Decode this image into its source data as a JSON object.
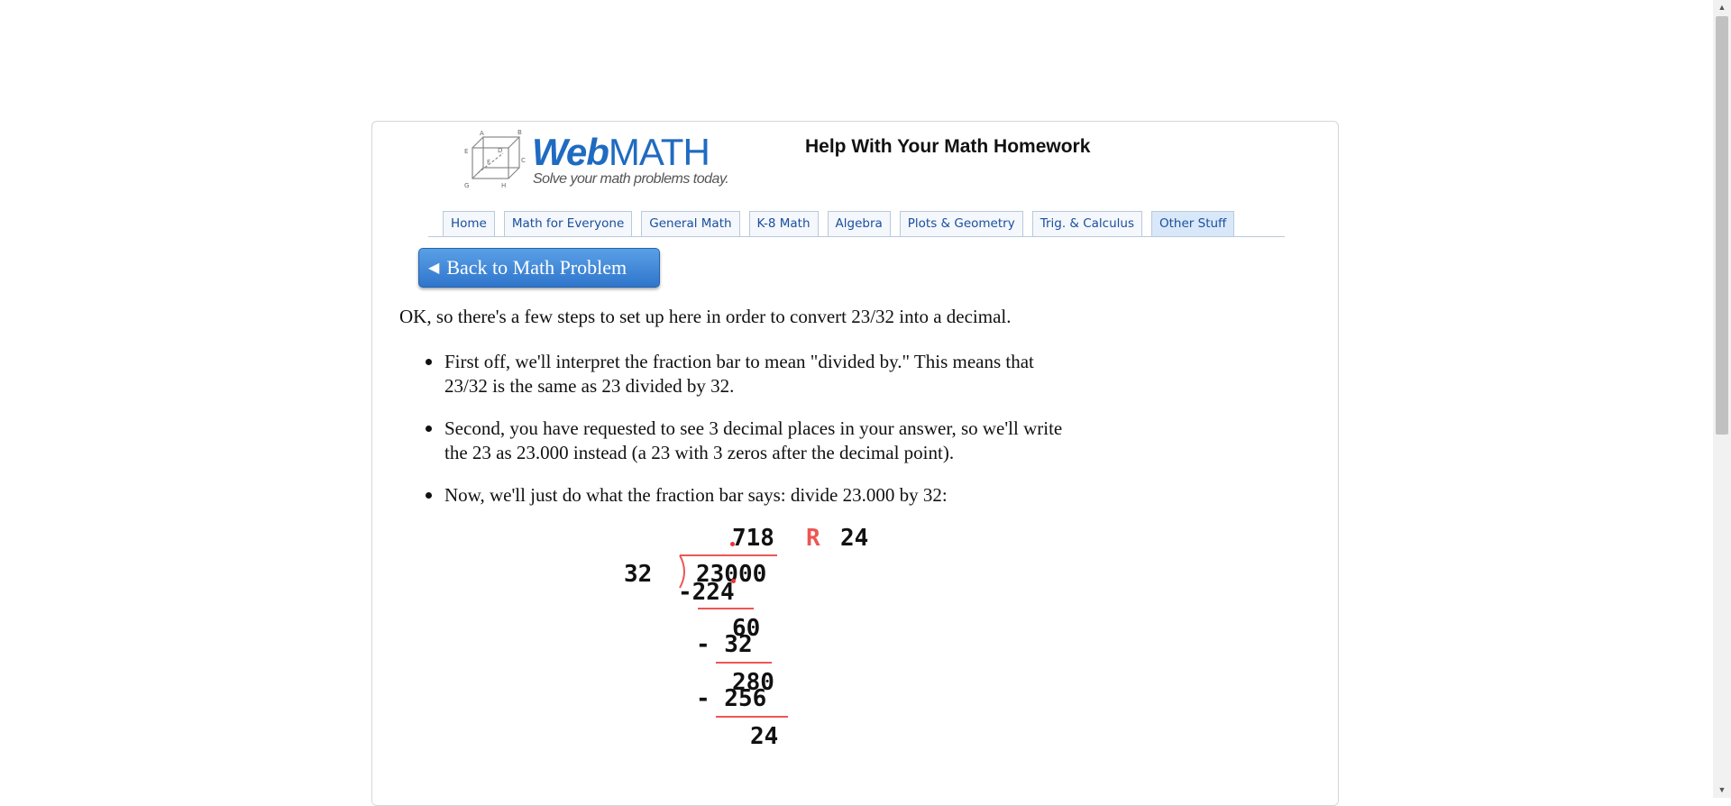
{
  "header": {
    "logo_word_a": "Web",
    "logo_word_b": "MATH",
    "logo_tagline": "Solve your math problems today.",
    "cube_labels": [
      "A",
      "B",
      "C",
      "D",
      "E",
      "F",
      "G",
      "H"
    ],
    "title": "Help With Your Math Homework"
  },
  "nav": {
    "tabs": [
      {
        "label": "Home"
      },
      {
        "label": "Math for Everyone"
      },
      {
        "label": "General Math"
      },
      {
        "label": "K-8 Math"
      },
      {
        "label": "Algebra"
      },
      {
        "label": "Plots & Geometry"
      },
      {
        "label": "Trig. & Calculus"
      },
      {
        "label": "Other Stuff"
      }
    ]
  },
  "back_button": {
    "icon": "left-triangle-icon",
    "label": "Back to Math Problem"
  },
  "content": {
    "intro": "OK, so there's a few steps to set up here in order to convert 23/32 into a decimal.",
    "steps": [
      {
        "line1": "First off, we'll interpret the fraction bar to mean \"divided by.\" This means that",
        "line2": "23/32 is the same as 23 divided by 32."
      },
      {
        "line1": "Second, you have requested to see 3 decimal places in your answer, so we'll write",
        "line2": "the 23 as 23.000 instead (a 23 with 3 zeros after the decimal point)."
      },
      {
        "line1": "Now, we'll just do what the fraction bar says: divide 23.000 by 32:",
        "line2": ""
      }
    ]
  },
  "division": {
    "quotient": "718",
    "remainder_mark": "R",
    "remainder": "24",
    "divisor": "32",
    "dividend": "23000",
    "step1_subtract": "-224",
    "step2_bring": "60",
    "step2_subtract": "- 32",
    "step3_bring": "280",
    "step3_subtract": "- 256",
    "final_remainder": "24"
  },
  "colors": {
    "accent": "#1f6bc1",
    "button": "#3a82d4",
    "division_marks": "#ee5555"
  }
}
